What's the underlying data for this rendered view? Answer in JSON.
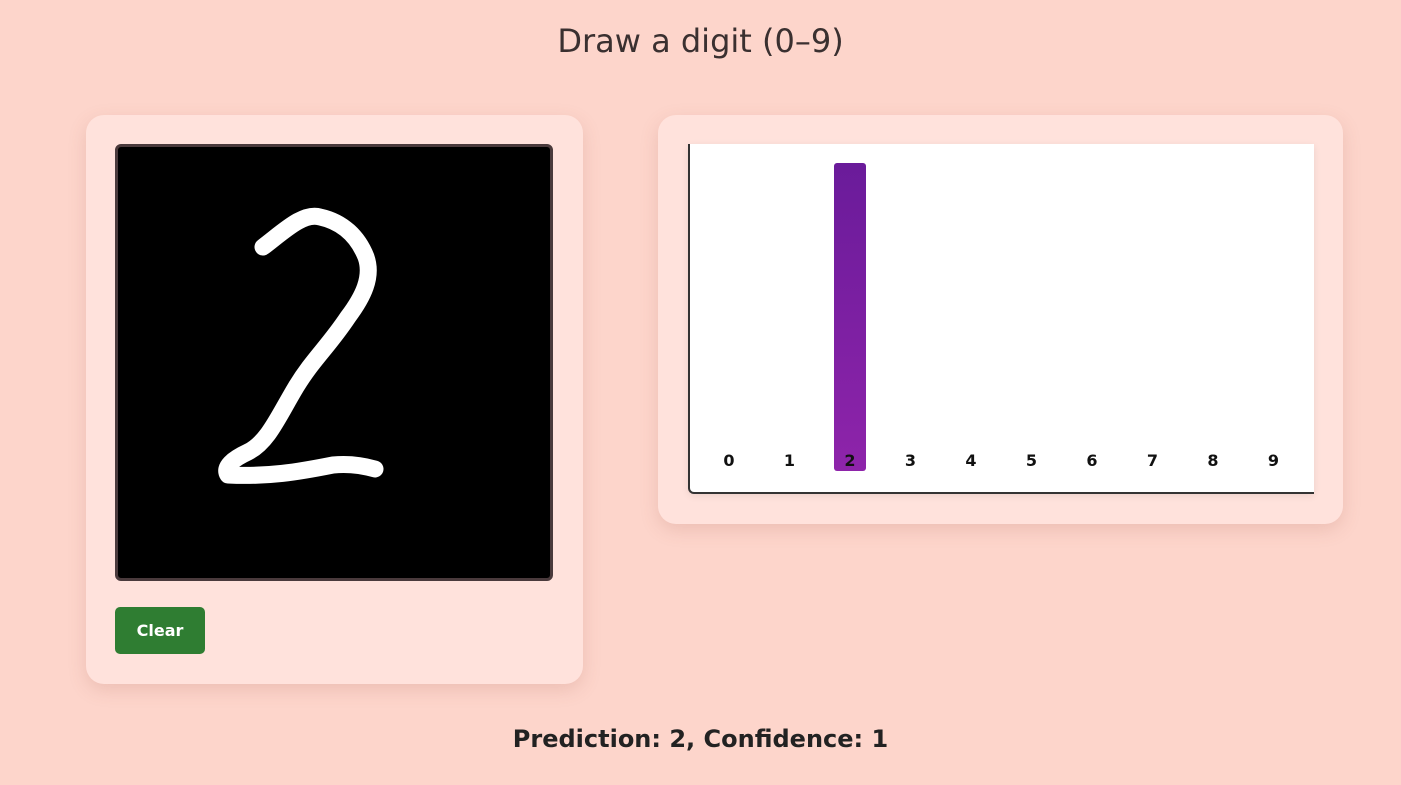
{
  "page": {
    "title": "Draw a digit (0–9)"
  },
  "draw_panel": {
    "clear_label": "Clear",
    "canvas_background": "#000000",
    "stroke_color": "#ffffff"
  },
  "prediction": {
    "text": "Prediction: 2, Confidence: 1",
    "digit": 2,
    "confidence": 1
  },
  "colors": {
    "page_background": "#fdd5cb",
    "card_background": "#ffe2dc",
    "button": "#2f7d32",
    "bar_top": "#6a1b9a",
    "bar_bottom": "#8e24aa"
  },
  "chart_data": {
    "type": "bar",
    "categories": [
      "0",
      "1",
      "2",
      "3",
      "4",
      "5",
      "6",
      "7",
      "8",
      "9"
    ],
    "values": [
      0,
      0,
      1,
      0,
      0,
      0,
      0,
      0,
      0,
      0
    ],
    "ylim": [
      0,
      1
    ],
    "title": "",
    "xlabel": "",
    "ylabel": "",
    "grid": false
  }
}
